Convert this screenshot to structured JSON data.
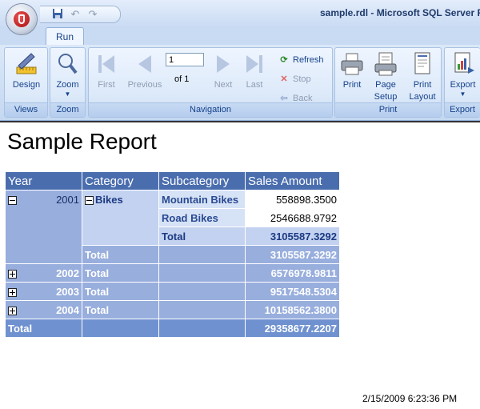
{
  "window": {
    "title": "sample.rdl - Microsoft SQL Server R"
  },
  "ribbon": {
    "tab": "Run",
    "groups": {
      "views": {
        "label": "Views",
        "design": "Design"
      },
      "zoom": {
        "label": "Zoom",
        "zoom": "Zoom"
      },
      "navigation": {
        "label": "Navigation",
        "first": "First",
        "previous": "Previous",
        "page_value": "1",
        "of_text": "of  1",
        "next": "Next",
        "last": "Last",
        "refresh": "Refresh",
        "stop": "Stop",
        "back": "Back"
      },
      "print": {
        "label": "Print",
        "print": "Print",
        "page_setup_1": "Page",
        "page_setup_2": "Setup",
        "print_layout_1": "Print",
        "print_layout_2": "Layout"
      },
      "export": {
        "label": "Export",
        "export": "Export"
      }
    }
  },
  "report": {
    "title": "Sample Report",
    "headers": {
      "year": "Year",
      "category": "Category",
      "subcategory": "Subcategory",
      "amount": "Sales Amount"
    },
    "rows": {
      "y2001": {
        "year": "2001",
        "category": "Bikes",
        "mountain": {
          "name": "Mountain Bikes",
          "amount": "558898.3500"
        },
        "road": {
          "name": "Road Bikes",
          "amount": "2546688.9792"
        },
        "subtotal": {
          "label": "Total",
          "amount": "3105587.3292"
        },
        "cat_total": {
          "label": "Total",
          "amount": "3105587.3292"
        }
      },
      "y2002": {
        "year": "2002",
        "label": "Total",
        "amount": "6576978.9811"
      },
      "y2003": {
        "year": "2003",
        "label": "Total",
        "amount": "9517548.5304"
      },
      "y2004": {
        "year": "2004",
        "label": "Total",
        "amount": "10158562.3800"
      },
      "grand": {
        "label": "Total",
        "amount": "29358677.2207"
      }
    },
    "timestamp": "2/15/2009 6:23:36 PM"
  }
}
